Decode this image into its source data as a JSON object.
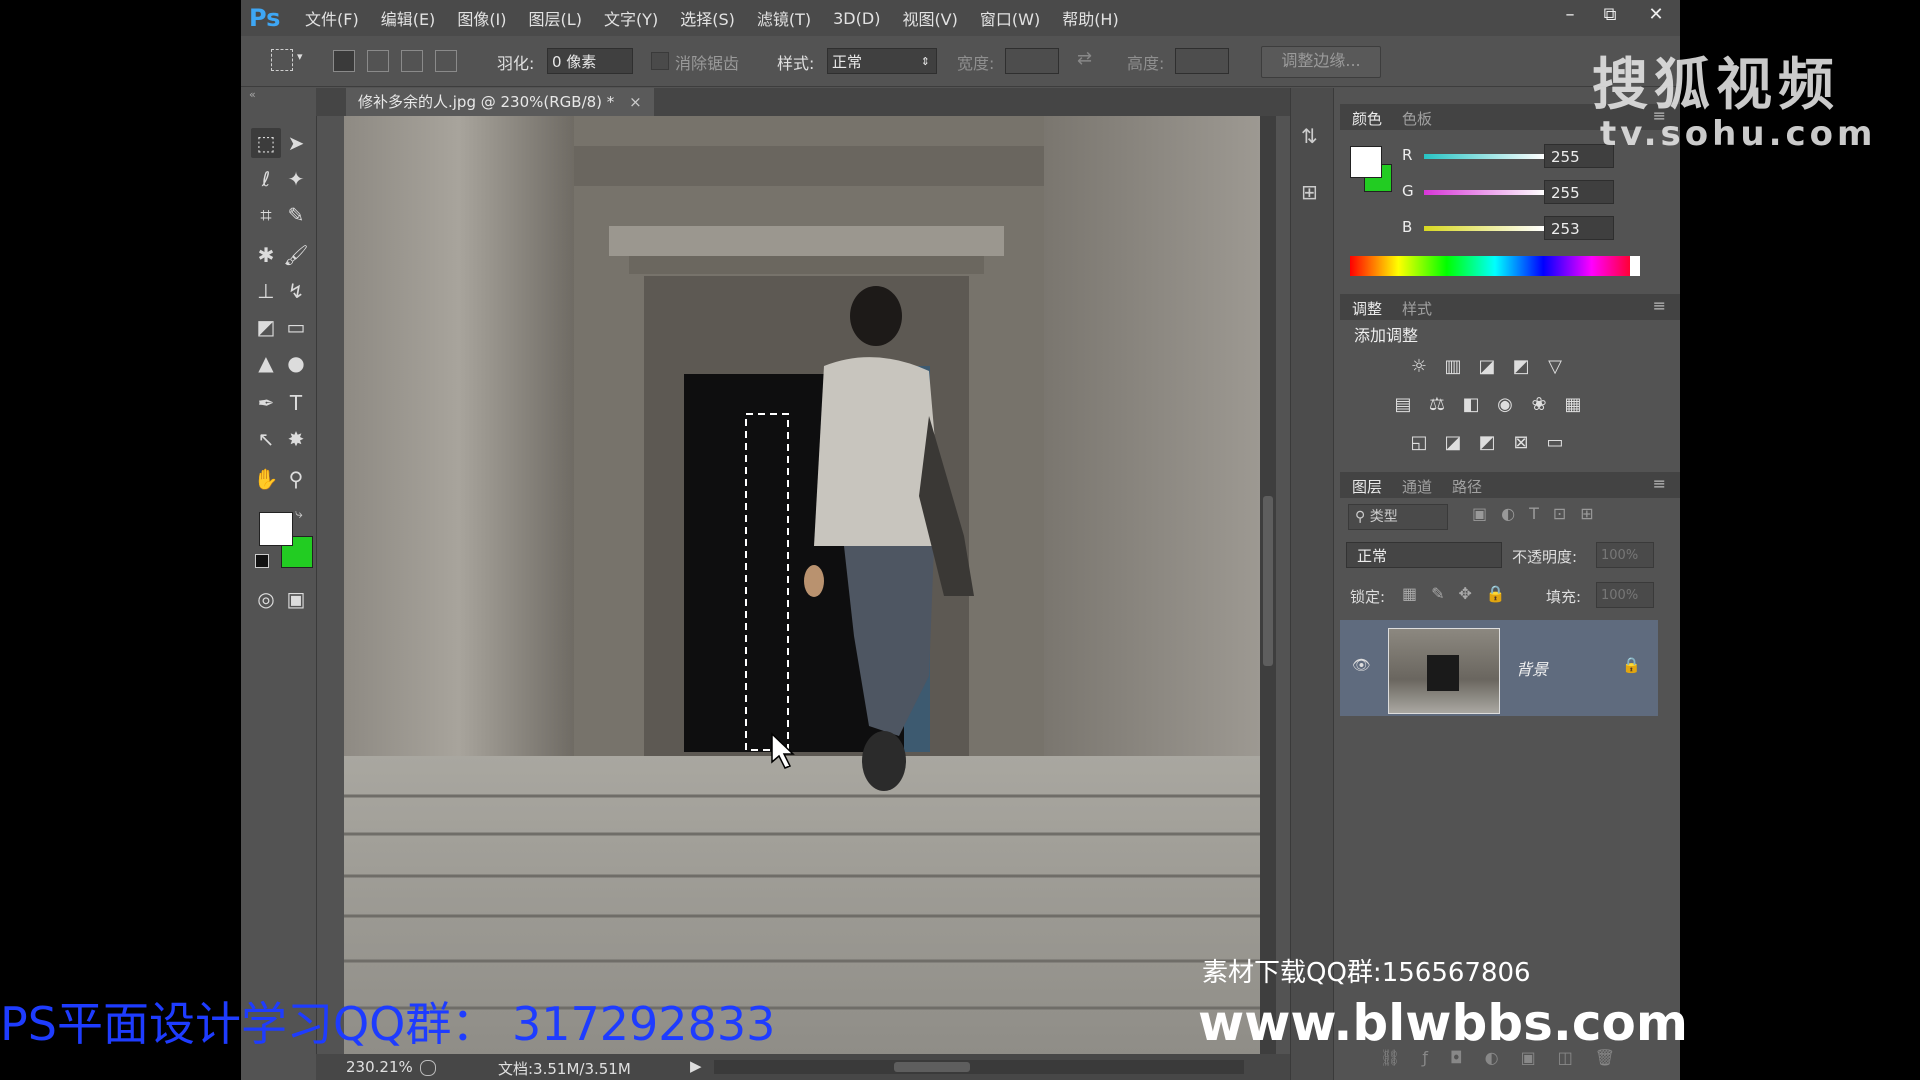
{
  "app": {
    "logo": "Ps",
    "menu": [
      "文件(F)",
      "编辑(E)",
      "图像(I)",
      "图层(L)",
      "文字(Y)",
      "选择(S)",
      "滤镜(T)",
      "3D(D)",
      "视图(V)",
      "窗口(W)",
      "帮助(H)"
    ],
    "window_controls": {
      "minimize": "–",
      "restore": "⧉",
      "close": "✕"
    }
  },
  "options_bar": {
    "feather_label": "羽化:",
    "feather_value": "0 像素",
    "antialias_label": "消除锯齿",
    "style_label": "样式:",
    "style_value": "正常",
    "width_label": "宽度:",
    "height_label": "高度:",
    "refine_edge_button": "调整边缘..."
  },
  "document": {
    "tab_title": "修补多余的人.jpg @ 230%(RGB/8) *",
    "tab_close": "×",
    "zoom": "230.21%",
    "doc_info": "文档:3.51M/3.51M"
  },
  "color_panel": {
    "tabs": [
      "颜色",
      "色板"
    ],
    "channels": [
      {
        "label": "R",
        "value": "255",
        "color": "#27c4c4"
      },
      {
        "label": "G",
        "value": "255",
        "color": "#d836d8"
      },
      {
        "label": "B",
        "value": "253",
        "color": "#d8d820"
      }
    ],
    "foreground": "#ffffff",
    "background": "#22cc22"
  },
  "adjustments_panel": {
    "tabs": [
      "调整",
      "样式"
    ],
    "title": "添加调整"
  },
  "layers_panel": {
    "tabs": [
      "图层",
      "通道",
      "路径"
    ],
    "filter_kind": "类型",
    "blend_mode": "正常",
    "opacity_label": "不透明度:",
    "opacity_value": "100%",
    "lock_label": "锁定:",
    "fill_label": "填充:",
    "fill_value": "100%",
    "layers": [
      {
        "name": "背景",
        "visible": true,
        "locked": true
      }
    ]
  },
  "overlays": {
    "sohu_brand": "搜狐视频",
    "sohu_url": "tv.sohu.com",
    "qq_group_material": "素材下载QQ群:156567806",
    "site_url": "www.blwbbs.com",
    "study_group": "PS平面设计学习QQ群： 317292833"
  }
}
